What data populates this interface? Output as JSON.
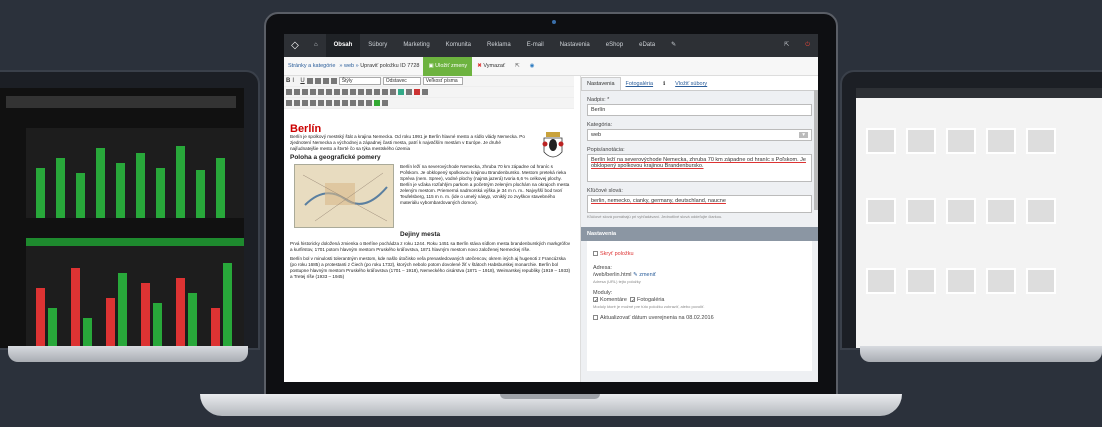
{
  "topnav": {
    "items": [
      "Obsah",
      "Súbory",
      "Marketing",
      "Komunita",
      "Reklama",
      "E-mail",
      "Nastavenia",
      "eShop",
      "eData"
    ]
  },
  "subnav": {
    "breadcrumb": "Stránky a kategórie",
    "crumb2": "web",
    "title": "Upraviť položku ID 7728",
    "save_label": "Uložiť zmeny",
    "delete_label": "Vymazať"
  },
  "toolbar": {
    "style_select": "Štýly",
    "format_select": "Odstavec",
    "size_select": "Veľkosť písma"
  },
  "article": {
    "title": "Berlín",
    "p1": "Berlín je spolkový mestský štát a krajina Nemecka. Od roku 1991 je Berlín hlavné mesto a sídlo vlády Nemecka. Po zjednotení Nemecka a východnej a západnej časti mesta, patrí k najväčším mestám v Európe. Je druhé najľudnatejšie mesto a štvrté čo sa týka mestského územia",
    "h2": "Poloha a geografické pomery",
    "p2": "Berlín leží na severovýchode Nemecka, zhruba 70 km západne od hraníc s Poľskom. Je obklopený spolkovou krajinou Brandenbursko. Mestom preteká rieka Spréva (nem. Spree), vodné plochy (najmä jazerá) tvoria 6,6 % celkovej plochy. Berlín je vďaka rozľahlým parkom a početným zeleným plochám na okrajoch mesta zeleným mestom. Priemerná nadmorská výška je 34 m n. m.. Najvyšší bod tvorí Teufelsberg, 115 m n. m. (ide o umelý násyp, vzniklý zo zvyškov stavebného materiálu vybombardovaných domov).",
    "h3": "Dejiny mesta",
    "p3": "Prvá historicky doložená zmienka o Berlíne pochádza z roku 1244. Roku 1451 sa Berlín stáva sídlom mesta brandenburských markgrófov a kurfirstov, 1701 potom hlavným mestom Pruského kráľovstva, 1871 hlavným mestom novo založenej Nemeckej ríše.",
    "p4": "Berlín bol v minulosti tolerantným mestom, kde našlo útočisko veľa prenasledovaných utečencov, okrem iných aj hugenoti z Francúzska (po roku 1685) a protestanti z Čiech (po roku 1732), ktorých nebolo potom dovolené žiť v štátoch Habsburskej monarchie. Berlín bol postupne hlavným mestom Pruského kráľovstva (1701 – 1918), Nemeckého cisárstva (1871 – 1918), Weimarskej republiky (1919 – 1933) a Tretej ríše (1933 – 1945)"
  },
  "sidepanel": {
    "tabs": [
      "Nastavenia",
      "Fotogaléria",
      "Vložiť súbory"
    ],
    "title_label": "Nadpis: *",
    "title_value": "Berlín",
    "category_label": "Kategória:",
    "category_value": "web",
    "perex_label": "Popis/anotácia:",
    "perex_value": "Berlín leží na severovýchode Nemecka, zhruba 70 km západne od hraníc s Poľskom. Je obklopený spolkovou krajinou Brandenbursko.",
    "keywords_label": "Kľúčové slová:",
    "keywords_value": "berlin, nemecko, cianky, germany, deutschland, naucne",
    "keywords_hint": "Kľúčové slová pomáhajú pri vyhľadávaní. Jednotlivé slová oddeľujte čiarkou.",
    "section_title": "Nastavenia",
    "stop_label": "Skryť položku",
    "address_label": "Adresa:",
    "address_value": "/web/berlin.html",
    "address_change": "zmeniť",
    "address_hint": "Adresa (URL) tejto položky",
    "modules_label": "Moduly:",
    "module1": "Komentáre",
    "module2": "Fotogaléria",
    "modules_hint": "Moduly ktoré je možné pre túto položku zobraziť, alebo povoliť.",
    "update_label": "Aktualizovať dátum uverejnenia na 08.02.2016"
  },
  "icons": {
    "logo": "diamond-logo-icon",
    "home": "home-icon",
    "settings": "wrench-icon",
    "exit": "power-icon"
  },
  "colors": {
    "accent_green": "#6db33f",
    "nav_dark": "#2d3035",
    "title_red": "#c00"
  }
}
